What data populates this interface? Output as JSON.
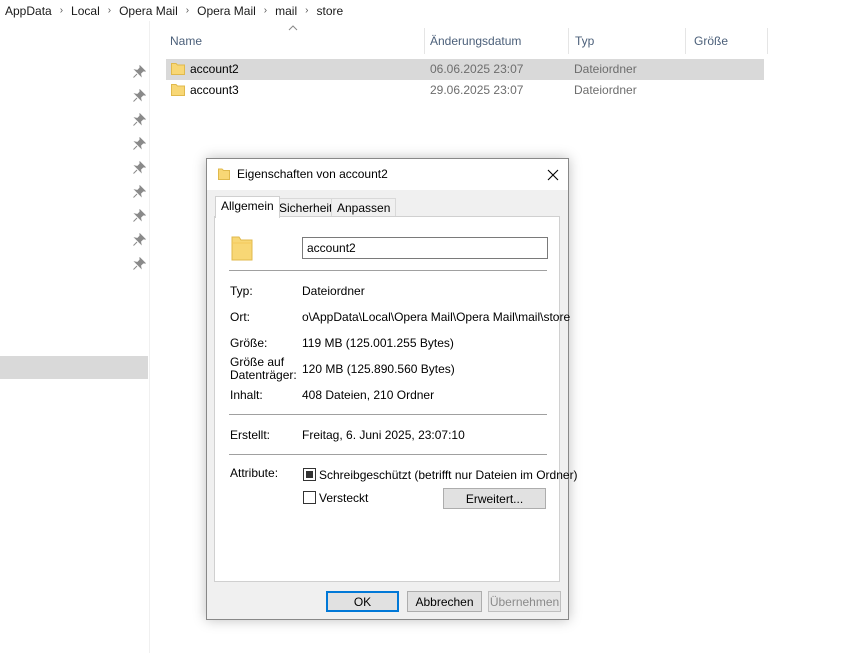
{
  "breadcrumb": [
    "AppData",
    "Local",
    "Opera Mail",
    "Opera Mail",
    "mail",
    "store"
  ],
  "columns": {
    "name": "Name",
    "date": "Änderungsdatum",
    "type": "Typ",
    "size": "Größe"
  },
  "files": [
    {
      "name": "account2",
      "date": "06.06.2025 23:07",
      "type": "Dateiordner",
      "selected": true
    },
    {
      "name": "account3",
      "date": "29.06.2025 23:07",
      "type": "Dateiordner",
      "selected": false
    }
  ],
  "dialog": {
    "title": "Eigenschaften von account2",
    "tabs": [
      "Allgemein",
      "Sicherheit",
      "Anpassen"
    ],
    "folder_name": "account2",
    "type_label": "Typ:",
    "type_value": "Dateiordner",
    "location_label": "Ort:",
    "location_value": "o\\AppData\\Local\\Opera Mail\\Opera Mail\\mail\\store",
    "size_label": "Größe:",
    "size_value": "119 MB (125.001.255 Bytes)",
    "disk_size_label_1": "Größe auf",
    "disk_size_label_2": "Datenträger:",
    "disk_size_value": "120 MB (125.890.560 Bytes)",
    "contents_label": "Inhalt:",
    "contents_value": "408 Dateien, 210 Ordner",
    "created_label": "Erstellt:",
    "created_value": "Freitag, 6. Juni 2025, 23:07:10",
    "attributes_label": "Attribute:",
    "readonly_label": "Schreibgeschützt (betrifft nur Dateien im Ordner)",
    "readonly_checked": "indeterminate",
    "hidden_label": "Versteckt",
    "hidden_checked": false,
    "advanced_button": "Erweitert...",
    "ok_button": "OK",
    "cancel_button": "Abbrechen",
    "apply_button": "Übernehmen"
  },
  "colors": {
    "selection": "#d9d9d9",
    "folder": "#f8d775",
    "default_button_border": "#0078d7"
  }
}
